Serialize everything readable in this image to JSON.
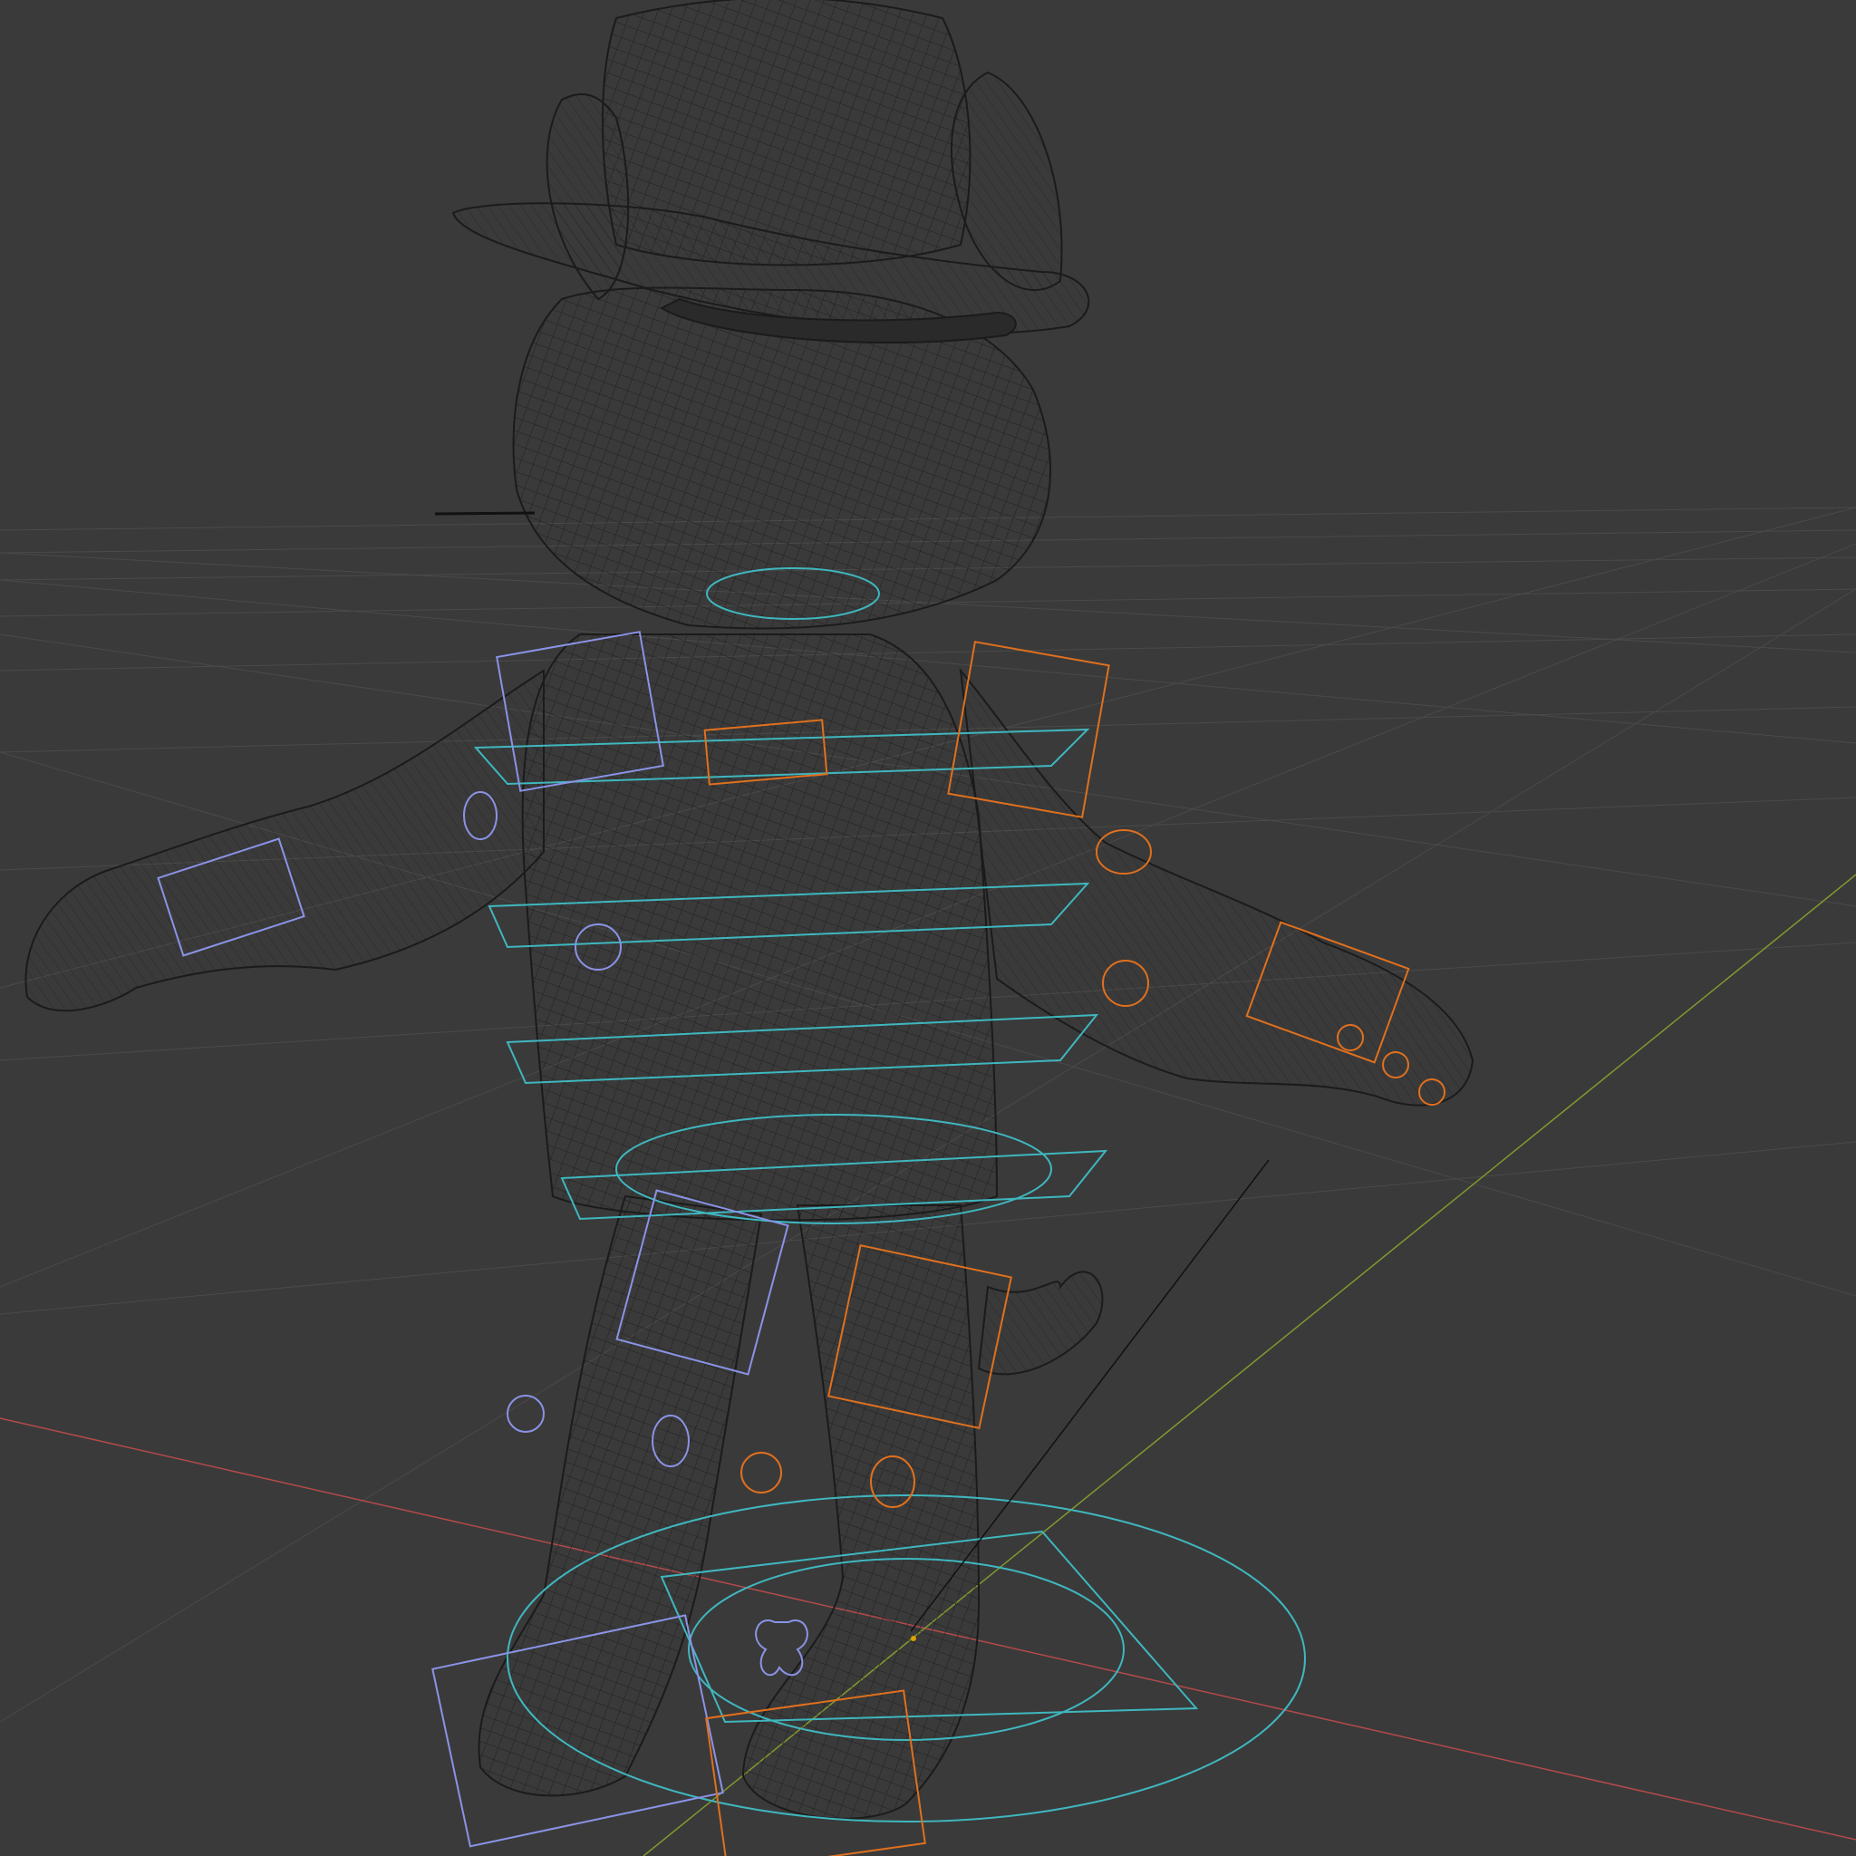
{
  "viewport": {
    "mode": "wireframe",
    "background": "#3a3a3a",
    "grid_color": "#4a4a4a",
    "axis_x_color": "#b34a4a",
    "axis_y_color": "#7f9a2e",
    "wire_color": "#1b1b1b",
    "control_colors": {
      "center": "#3fb7bf",
      "left_side": "#8a93e6",
      "right_side": "#e0701e"
    },
    "objects": [
      {
        "name": "character-mesh",
        "kind": "mesh"
      },
      {
        "name": "armature-controls",
        "kind": "rig"
      }
    ]
  }
}
